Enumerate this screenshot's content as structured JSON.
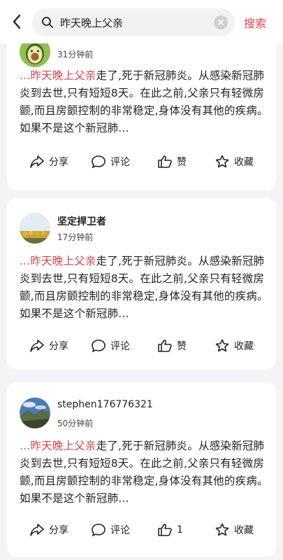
{
  "search": {
    "query": "昨天晚上父亲",
    "submit_label": "搜索"
  },
  "posts": [
    {
      "username": "",
      "time": "31分钟前",
      "highlight": "...昨天晚上父亲",
      "body": "走了,死于新冠肺炎。从感染新冠肺炎到去世,只有短短8天。在此之前,父亲只有轻微房颤,而且房颤控制的非常稳定,身体没有其他的疾病。 如果不是这个新冠肺...",
      "actions": {
        "share": "分享",
        "comment": "评论",
        "like": "赞",
        "favorite": "收藏"
      }
    },
    {
      "username": "坚定捍卫者",
      "time": "17分钟前",
      "highlight": "...昨天晚上父亲",
      "body": "走了,死于新冠肺炎。从感染新冠肺炎到去世,只有短短8天。在此之前,父亲只有轻微房颤,而且房颤控制的非常稳定,身体没有其他的疾病。 如果不是这个新冠肺...",
      "actions": {
        "share": "分享",
        "comment": "评论",
        "like": "赞",
        "favorite": "收藏"
      }
    },
    {
      "username": "stephen176776321",
      "time": "50分钟前",
      "highlight": "...昨天晚上父亲",
      "body": "走了,死于新冠肺炎。从感染新冠肺炎到去世,只有短短8天。在此之前,父亲只有轻微房颤,而且房颤控制的非常稳定,身体没有其他的疾病。 如果不是这个新冠肺...",
      "actions": {
        "share": "分享",
        "comment": "评论",
        "like": "1",
        "favorite": "收藏"
      }
    }
  ],
  "colors": {
    "accent": "#e0434f",
    "highlight": "#d0464e",
    "background": "#f4f4f6"
  },
  "icons": [
    "back-arrow-icon",
    "search-icon",
    "clear-icon",
    "share-icon",
    "comment-icon",
    "like-icon",
    "favorite-icon"
  ]
}
